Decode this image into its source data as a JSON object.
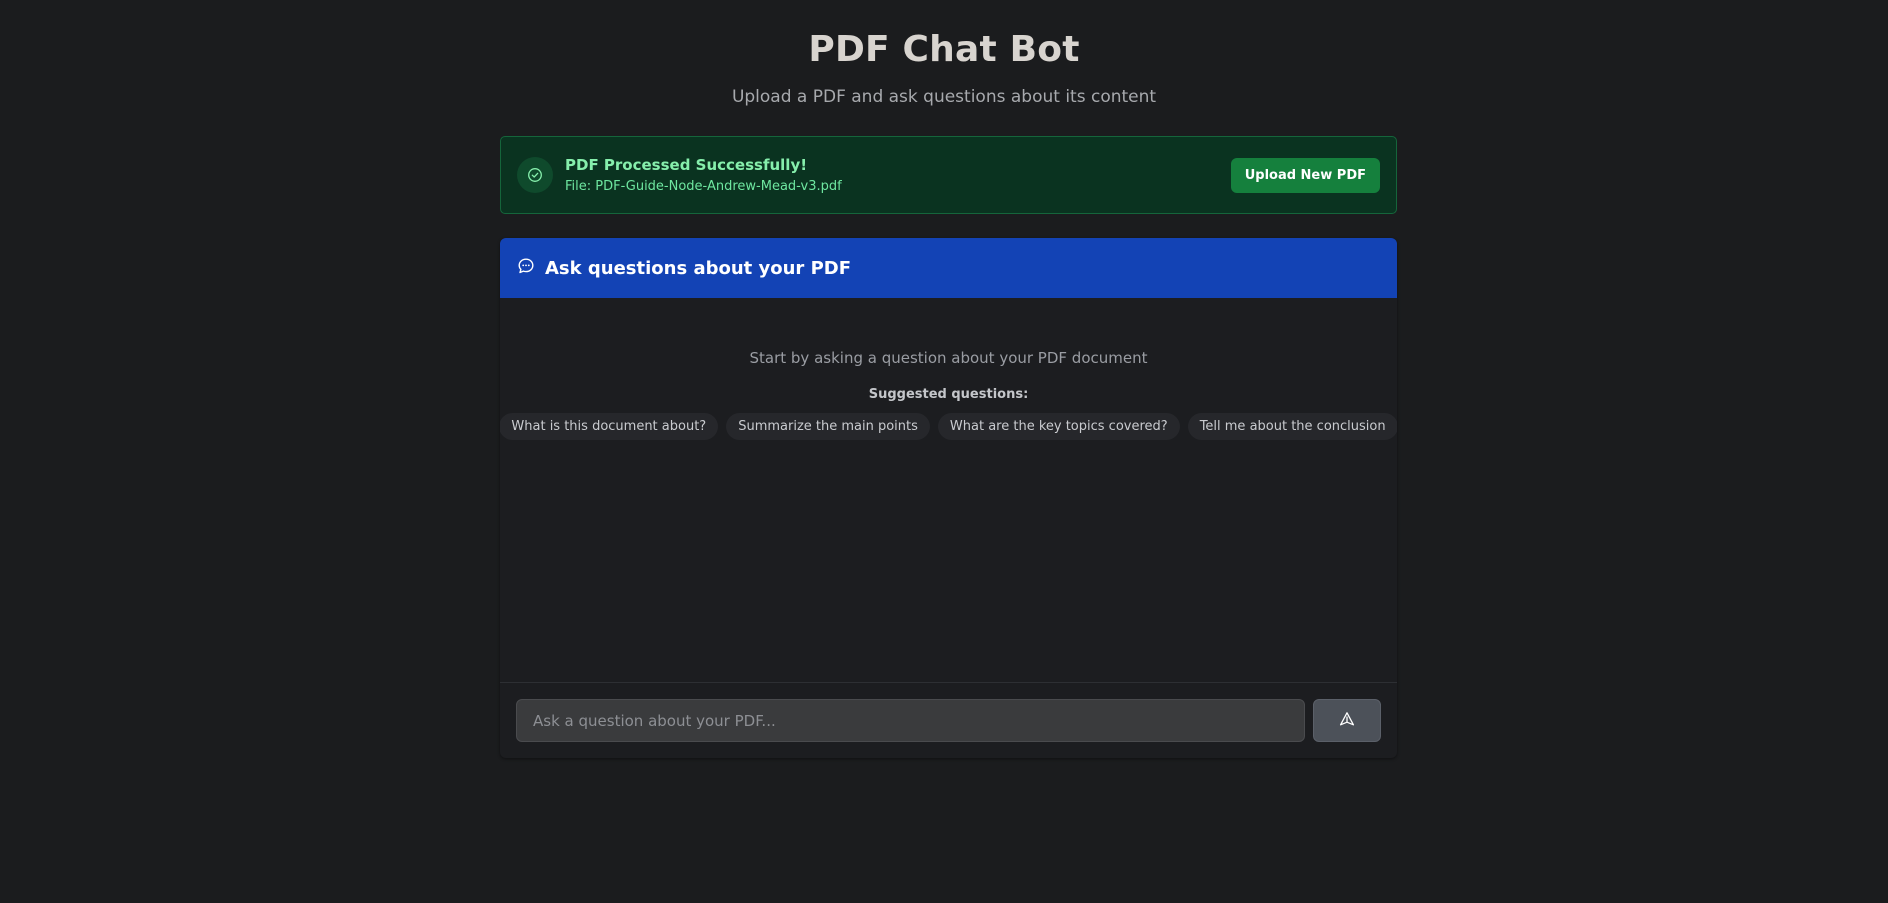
{
  "header": {
    "title": "PDF Chat Bot",
    "subtitle": "Upload a PDF and ask questions about its content"
  },
  "status": {
    "title": "PDF Processed Successfully!",
    "file_label": "File: PDF-Guide-Node-Andrew-Mead-v3.pdf",
    "icon": "check-circle-icon",
    "upload_button_label": "Upload New PDF"
  },
  "chat": {
    "header_icon": "chat-bubble-icon",
    "header_title": "Ask questions about your PDF",
    "empty_message": "Start by asking a question about your PDF document",
    "suggested_label": "Suggested questions:",
    "suggestions": [
      "What is this document about?",
      "Summarize the main points",
      "What are the key topics covered?",
      "Tell me about the conclusion"
    ],
    "input_placeholder": "Ask a question about your PDF...",
    "input_value": "",
    "send_icon": "send-icon"
  },
  "colors": {
    "background": "#1b1c1e",
    "success_bg": "#0a3320",
    "success_accent": "#15803d",
    "header_blue": "#1343b5"
  }
}
